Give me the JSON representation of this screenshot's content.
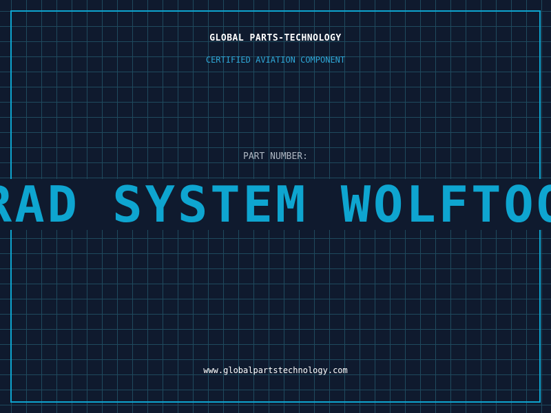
{
  "header": {
    "company": "GLOBAL PARTS-TECHNOLOGY",
    "subtitle": "CERTIFIED AVIATION COMPONENT"
  },
  "main": {
    "part_number_label": "PART NUMBER:",
    "part_number_value": "TRAD SYSTEM WOLFTOOL"
  },
  "footer": {
    "url": "www.globalpartstechnology.com"
  },
  "colors": {
    "background": "#0f1a2e",
    "grid": "#1f4a5e",
    "accent": "#0ea5d0",
    "subtitle": "#2fa8d8",
    "label": "#aeb7c2",
    "text": "#ffffff"
  }
}
